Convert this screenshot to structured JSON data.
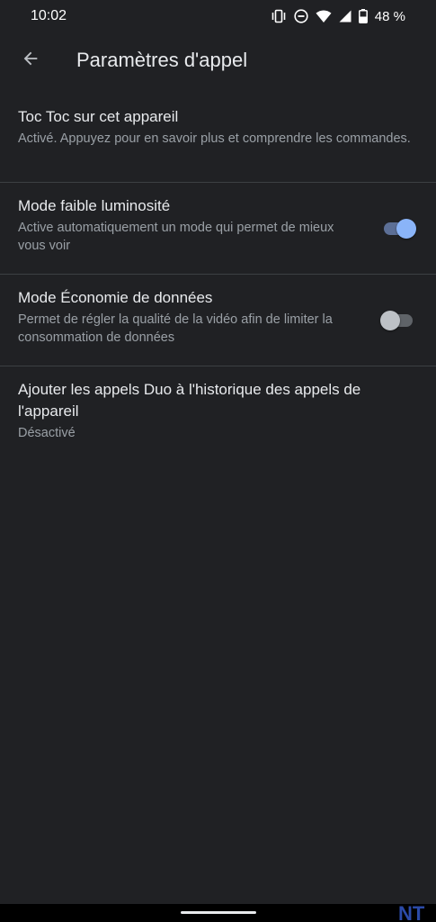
{
  "status_bar": {
    "time": "10:02",
    "battery": "48 %",
    "icons": [
      "vibrate-icon",
      "do-not-disturb-icon",
      "wifi-icon",
      "cellular-signal-icon",
      "battery-icon"
    ]
  },
  "app_bar": {
    "back_icon": "arrow-back-icon",
    "title": "Paramètres d'appel"
  },
  "settings": [
    {
      "title": "Toc Toc sur cet appareil",
      "summary": "Activé. Appuyez pour en savoir plus et comprendre les commandes."
    },
    {
      "title": "Mode faible luminosité",
      "summary": "Active automatiquement un mode qui permet de mieux vous voir",
      "toggle": true
    },
    {
      "title": "Mode Économie de données",
      "summary": "Permet de régler la qualité de la vidéo afin de limiter la consommation de données",
      "toggle": false
    },
    {
      "title": "Ajouter les appels Duo à l'historique des appels de l'appareil",
      "summary": "Désactivé"
    }
  ],
  "colors": {
    "background": "#202124",
    "accent": "#8ab4f8",
    "divider": "#3c4043",
    "primary_text": "#e8eaed",
    "secondary_text": "#9aa0a6"
  },
  "watermark": "NT"
}
